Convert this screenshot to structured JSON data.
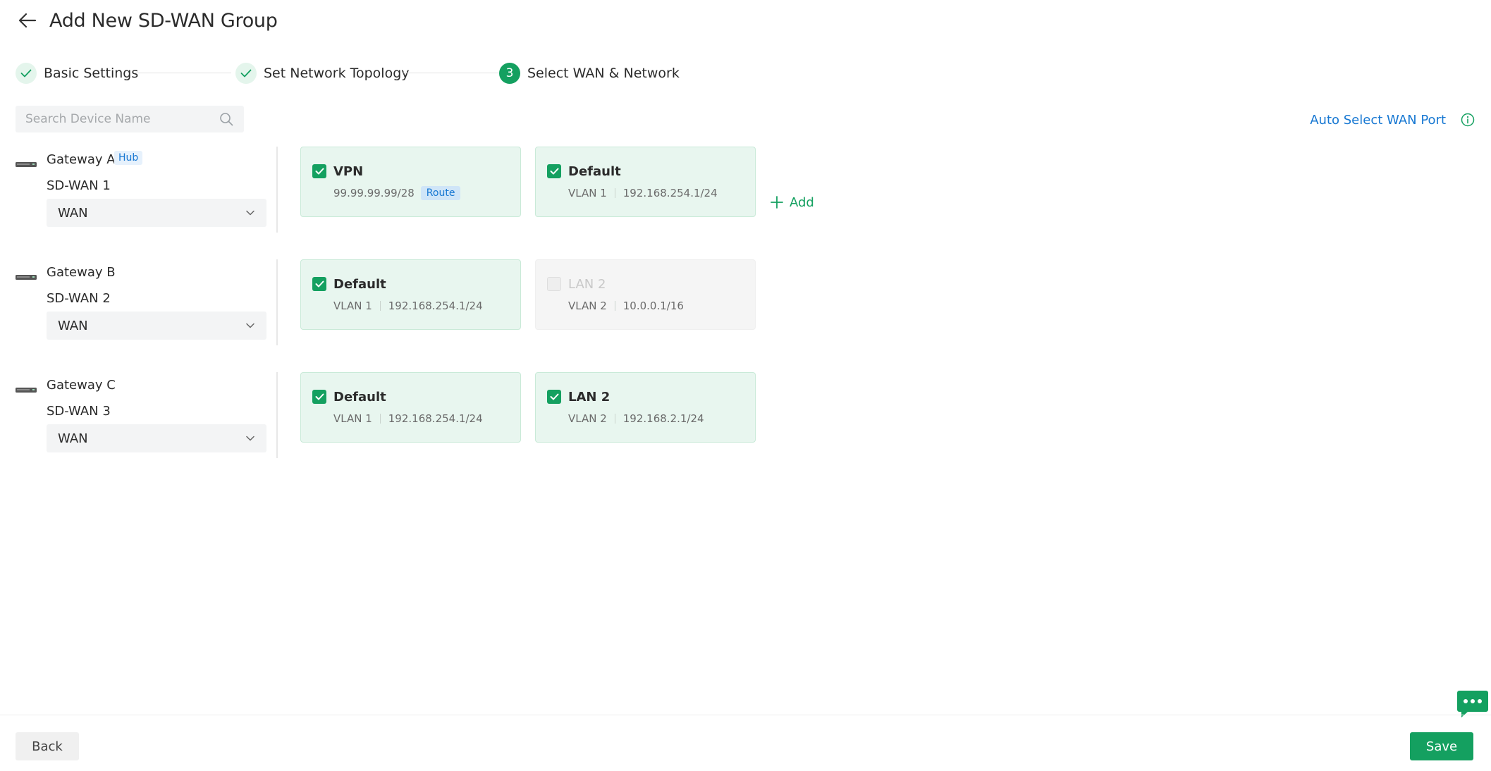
{
  "header": {
    "title": "Add New SD-WAN Group",
    "back_icon": "arrow-left-icon"
  },
  "stepper": {
    "steps": [
      {
        "label": "Basic Settings",
        "state": "done"
      },
      {
        "label": "Set Network Topology",
        "state": "done"
      },
      {
        "label": "Select WAN & Network",
        "state": "active",
        "number": "3"
      }
    ]
  },
  "search": {
    "placeholder": "Search Device Name",
    "value": ""
  },
  "auto_select": {
    "label": "Auto Select WAN Port",
    "icon": "info-icon"
  },
  "gateways": [
    {
      "name": "Gateway A",
      "badge": "Hub",
      "sdwan": "SD-WAN 1",
      "wan": "WAN",
      "networks": [
        {
          "title": "VPN",
          "sub1": "99.99.99.99/28",
          "sub2": "",
          "badge": "Route",
          "checked": true
        },
        {
          "title": "Default",
          "sub1": "VLAN 1",
          "sub2": "192.168.254.1/24",
          "checked": true
        }
      ],
      "add_label": "Add"
    },
    {
      "name": "Gateway B",
      "sdwan": "SD-WAN 2",
      "wan": "WAN",
      "networks": [
        {
          "title": "Default",
          "sub1": "VLAN 1",
          "sub2": "192.168.254.1/24",
          "checked": true
        },
        {
          "title": "LAN 2",
          "sub1": "VLAN 2",
          "sub2": "10.0.0.1/16",
          "checked": false,
          "disabled": true
        }
      ]
    },
    {
      "name": "Gateway C",
      "sdwan": "SD-WAN 3",
      "wan": "WAN",
      "networks": [
        {
          "title": "Default",
          "sub1": "VLAN 1",
          "sub2": "192.168.254.1/24",
          "checked": true
        },
        {
          "title": "LAN 2",
          "sub1": "VLAN 2",
          "sub2": "192.168.2.1/24",
          "checked": true
        }
      ]
    }
  ],
  "footer": {
    "back_label": "Back",
    "save_label": "Save"
  },
  "colors": {
    "accent": "#14a060",
    "link": "#1677d2",
    "card_bg": "#e8f6ef",
    "disabled_bg": "#f5f5f5"
  }
}
